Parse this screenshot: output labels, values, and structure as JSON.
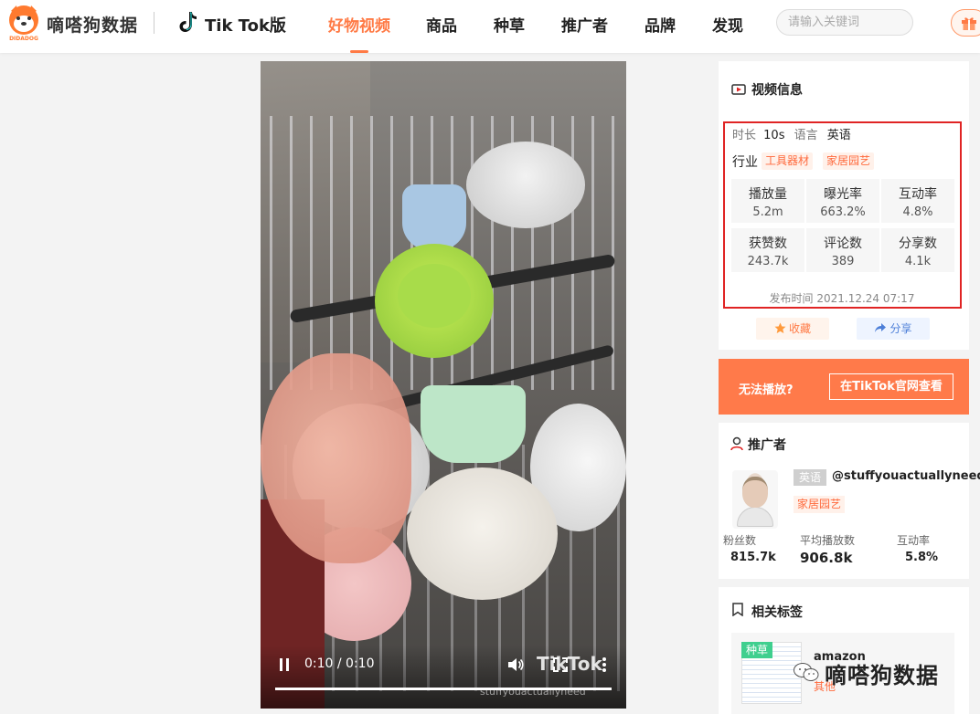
{
  "header": {
    "logo_text": "嘀嗒狗数据",
    "logo_sub": "DIDADOG",
    "platform": "Tik Tok版",
    "nav": [
      {
        "label": "好物视频",
        "active": true
      },
      {
        "label": "商品",
        "active": false
      },
      {
        "label": "种草",
        "active": false
      },
      {
        "label": "推广者",
        "active": false
      },
      {
        "label": "品牌",
        "active": false
      },
      {
        "label": "发现",
        "active": false
      }
    ],
    "search_placeholder": "请输入关键词",
    "icons": [
      "didadog-logo-icon",
      "tiktok-icon",
      "gift-icon"
    ]
  },
  "video": {
    "time": "0:10 / 0:10",
    "progress": 1.0,
    "watermark": "TikTok",
    "username": "stuffyouactuallyneed",
    "icons": [
      "pause-icon",
      "volume-icon",
      "fullscreen-icon",
      "more-icon"
    ]
  },
  "video_info": {
    "title": "视频信息",
    "duration_label": "时长",
    "duration": "10s",
    "language_label": "语言",
    "language": "英语",
    "industry_label": "行业",
    "industries": [
      "工具器材",
      "家居园艺"
    ],
    "stats": [
      {
        "label": "播放量",
        "value": "5.2m"
      },
      {
        "label": "曝光率",
        "value": "663.2%"
      },
      {
        "label": "互动率",
        "value": "4.8%"
      },
      {
        "label": "获赞数",
        "value": "243.7k"
      },
      {
        "label": "评论数",
        "value": "389"
      },
      {
        "label": "分享数",
        "value": "4.1k"
      }
    ],
    "published": "发布时间 2021.12.24 07:17",
    "favorite_label": "收藏",
    "share_label": "分享"
  },
  "cant_play": {
    "question": "无法播放?",
    "button": "在TikTok官网查看"
  },
  "promoter": {
    "title": "推广者",
    "language_badge": "英语",
    "handle": "@stuffyouactuallyneed",
    "category": "家居园艺",
    "stats": [
      {
        "label": "粉丝数",
        "value": "815.7k"
      },
      {
        "label": "平均播放数",
        "value": "906.8k"
      },
      {
        "label": "互动率",
        "value": "5.8%"
      }
    ]
  },
  "related_tags": {
    "title": "相关标签",
    "items": [
      {
        "badge": "种草",
        "name": "amazon",
        "sub": "其他"
      }
    ]
  },
  "watermark": "嘀嗒狗数据",
  "colors": {
    "accent": "#ff7a45",
    "highlight_box": "#e02424",
    "tag_bg": "#fff1ea",
    "tag_text": "#ff6a3d",
    "green_badge": "#3fcf8e"
  }
}
